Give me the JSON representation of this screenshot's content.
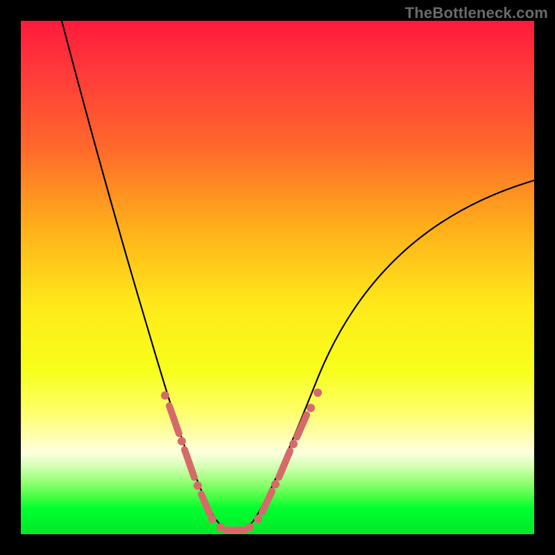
{
  "watermark": "TheBottleneck.com",
  "colors": {
    "background": "#000000",
    "curve": "#000000",
    "markers": "#d66a6a",
    "gradient_top": "#ff1a3c",
    "gradient_bottom": "#00e828"
  },
  "chart_data": {
    "type": "line",
    "title": "",
    "xlabel": "",
    "ylabel": "",
    "xlim": [
      0,
      100
    ],
    "ylim": [
      0,
      100
    ],
    "series": [
      {
        "name": "bottleneck-curve",
        "x": [
          8,
          12,
          16,
          20,
          24,
          27,
          30,
          32,
          34,
          35.5,
          37,
          38.5,
          40,
          42,
          44,
          47,
          51,
          56,
          62,
          70,
          80,
          90,
          100
        ],
        "y": [
          100,
          88,
          72,
          56,
          40,
          28,
          18,
          11,
          6,
          2.5,
          0.5,
          0.5,
          1.5,
          5,
          10,
          18,
          28,
          38,
          48,
          57,
          64,
          68,
          70
        ]
      }
    ],
    "markers": {
      "name": "highlight-segment",
      "description": "Pink dotted/segmented overlay near the curve minimum",
      "x": [
        27.5,
        28.5,
        29.5,
        30.5,
        31.5,
        33,
        34,
        35,
        36,
        37,
        38,
        39,
        40,
        41,
        42.5,
        43.5,
        44.5,
        46,
        47.5
      ],
      "y": [
        27,
        24,
        21,
        18,
        15,
        10,
        7,
        3.5,
        1,
        0.5,
        0.5,
        1,
        2.5,
        5,
        9,
        12.5,
        16,
        20,
        25
      ]
    },
    "background_gradient": "vertical red→orange→yellow→pale→green (qualitative good/bad scale)"
  }
}
